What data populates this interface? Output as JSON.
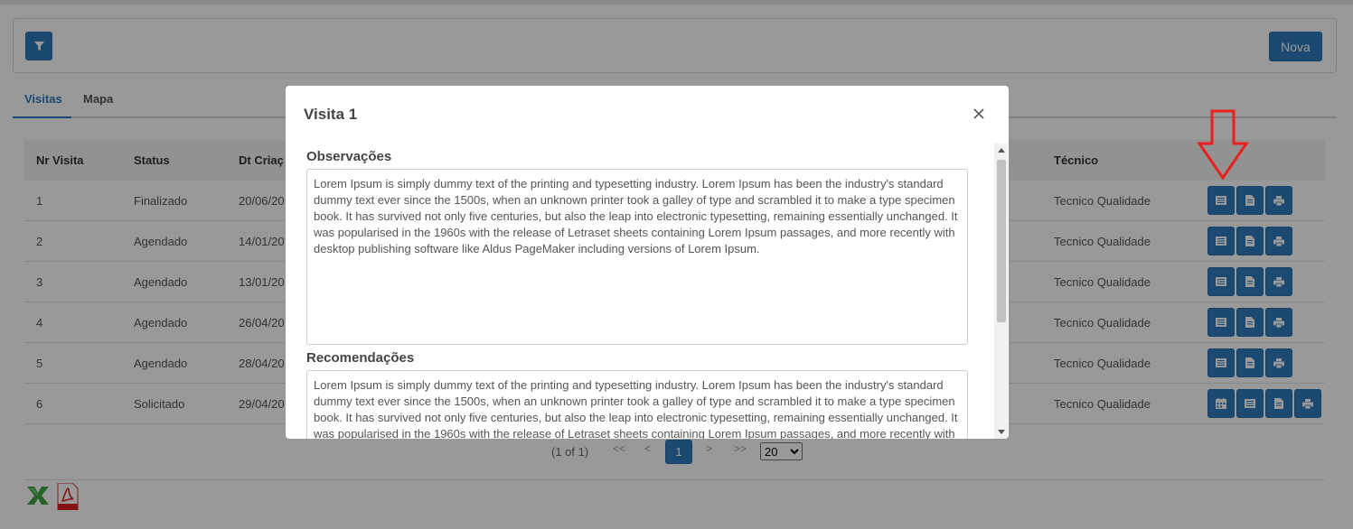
{
  "toolbar": {
    "filter_icon": "filter-icon",
    "new_label": "Nova"
  },
  "tabs": [
    {
      "label": "Visitas",
      "active": true
    },
    {
      "label": "Mapa",
      "active": false
    }
  ],
  "table": {
    "headers": {
      "nr": "Nr Visita",
      "status": "Status",
      "dt": "Dt Criaç",
      "tecnico": "Técnico"
    },
    "rows": [
      {
        "nr": "1",
        "status": "Finalizado",
        "dt": "20/06/20",
        "tecnico": "Tecnico Qualidade"
      },
      {
        "nr": "2",
        "status": "Agendado",
        "dt": "14/01/20",
        "tecnico": "Tecnico Qualidade"
      },
      {
        "nr": "3",
        "status": "Agendado",
        "dt": "13/01/20",
        "tecnico": "Tecnico Qualidade"
      },
      {
        "nr": "4",
        "status": "Agendado",
        "dt": "26/04/20",
        "tecnico": "Tecnico Qualidade"
      },
      {
        "nr": "5",
        "status": "Agendado",
        "dt": "28/04/20",
        "tecnico": "Tecnico Qualidade"
      },
      {
        "nr": "6",
        "status": "Solicitado",
        "dt": "29/04/20",
        "tecnico": "Tecnico Qualidade"
      }
    ]
  },
  "pager": {
    "info": "(1 of 1)",
    "first": "<<",
    "prev": "<",
    "page": "1",
    "next": ">",
    "last": ">>",
    "page_size": "20"
  },
  "modal": {
    "title": "Visita 1",
    "observacoes_label": "Observações",
    "observacoes_text": "Lorem Ipsum is simply dummy text of the printing and typesetting industry. Lorem Ipsum has been the industry's standard dummy text ever since the 1500s, when an unknown printer took a galley of type and scrambled it to make a type specimen book. It has survived not only five centuries, but also the leap into electronic typesetting, remaining essentially unchanged. It was popularised in the 1960s with the release of Letraset sheets containing Lorem Ipsum passages, and more recently with desktop publishing software like Aldus PageMaker including versions of Lorem Ipsum.",
    "recomendacoes_label": "Recomendações",
    "recomendacoes_text": "Lorem Ipsum is simply dummy text of the printing and typesetting industry. Lorem Ipsum has been the industry's standard dummy text ever since the 1500s, when an unknown printer took a galley of type and scrambled it to make a type specimen book. It has survived not only five centuries, but also the leap into electronic typesetting, remaining essentially unchanged. It was popularised in the 1960s with the release of Letraset sheets containing Lorem Ipsum passages, and more recently with desktop publishing software like Aldus PageMaker including versions of Lorem Ipsum."
  },
  "colors": {
    "accent": "#2f7bbd",
    "annotation_arrow": "#e8201f",
    "overlay": "rgba(0,0,0,0.4)"
  }
}
